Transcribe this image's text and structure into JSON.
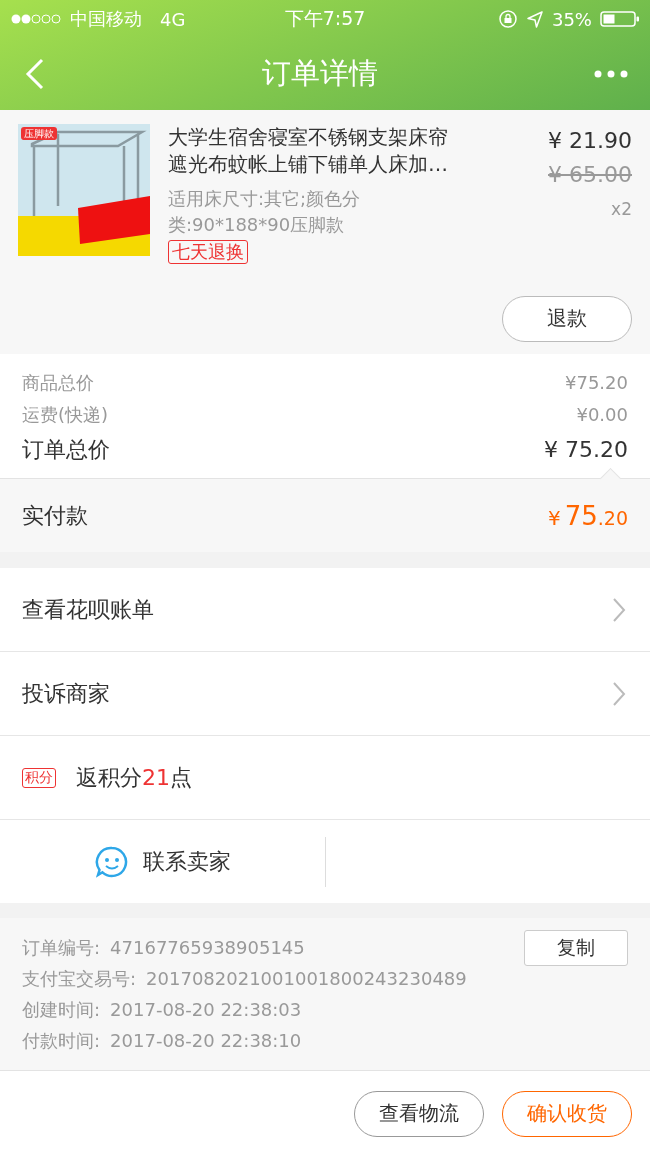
{
  "status_bar": {
    "carrier": "中国移动",
    "network": "4G",
    "time": "下午7:57",
    "battery": "35%"
  },
  "nav": {
    "title": "订单详情"
  },
  "product": {
    "tag": "压脚款",
    "title": "大学生宿舍寝室不锈钢支架床帘遮光布蚊帐上铺下铺单人床加…",
    "specs": "适用床尺寸:其它;颜色分类:90*188*90压脚款",
    "badge": "七天退换",
    "price": "¥ 21.90",
    "original_price": "¥ 65.00",
    "quantity": "x2",
    "refund_button": "退款"
  },
  "totals": [
    {
      "label": "商品总价",
      "value": "¥75.20",
      "kind": "minor"
    },
    {
      "label": "运费(快递)",
      "value": "¥0.00",
      "kind": "minor"
    },
    {
      "label": "订单总价",
      "value": "¥ 75.20",
      "kind": "major"
    }
  ],
  "paid": {
    "label": "实付款",
    "currency": "¥",
    "integer": "75",
    "decimals": ".20"
  },
  "links": [
    {
      "label": "查看花呗账单"
    },
    {
      "label": "投诉商家"
    }
  ],
  "points": {
    "tag": "积分",
    "prefix": "返积分",
    "amount": "21",
    "suffix": "点"
  },
  "contact": {
    "label": "联系卖家"
  },
  "info": [
    {
      "label": "订单编号:",
      "value": "47167765938905145"
    },
    {
      "label": "支付宝交易号:",
      "value": "2017082021001001800243230489"
    },
    {
      "label": "创建时间:",
      "value": "2017-08-20 22:38:03"
    },
    {
      "label": "付款时间:",
      "value": "2017-08-20 22:38:10"
    }
  ],
  "copy_button": "复制",
  "actions": [
    {
      "label": "查看物流",
      "kind": "plain"
    },
    {
      "label": "确认收货",
      "kind": "primary"
    }
  ]
}
